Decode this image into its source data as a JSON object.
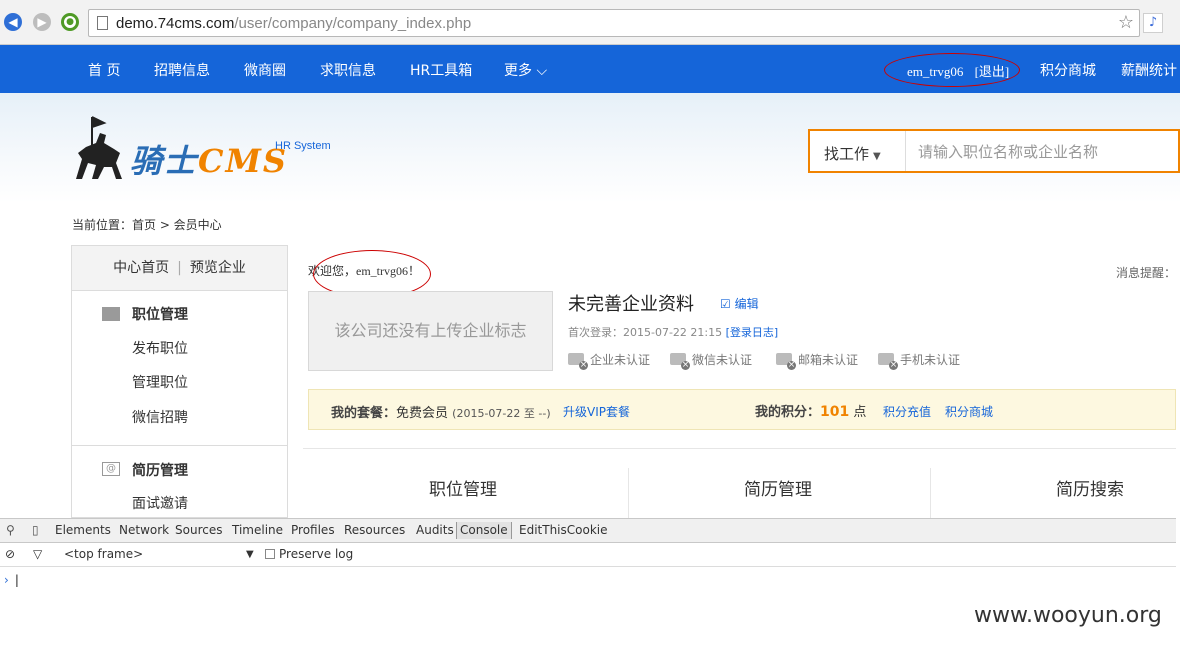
{
  "browser": {
    "url_host": "demo.74cms.com",
    "url_path": "/user/company/company_index.php"
  },
  "topnav": {
    "items": [
      "首 页",
      "招聘信息",
      "微商圈",
      "求职信息",
      "HR工具箱",
      "更多 ⌵"
    ],
    "username": "em_trvg06",
    "logout": "[退出]",
    "points_mall": "积分商城",
    "salary_stats": "薪酬统计"
  },
  "header": {
    "logo_text_main": "骑士",
    "logo_text_cms": "CMS",
    "hr_system": "HR System",
    "search_select": "找工作",
    "search_placeholder": "请输入职位名称或企业名称"
  },
  "breadcrumb": "当前位置：首页 > 会员中心",
  "sidebar": {
    "center_home": "中心首页",
    "preview_company": "预览企业",
    "groups": [
      {
        "title": "职位管理",
        "items": [
          "发布职位",
          "管理职位",
          "微信招聘"
        ]
      },
      {
        "title": "简历管理",
        "items": [
          "面试邀请"
        ]
      }
    ]
  },
  "main": {
    "welcome_prefix": "欢迎您，",
    "welcome_user": "em_trvg06",
    "welcome_suffix": "！",
    "message_hint": "消息提醒：",
    "no_logo": "该公司还没有上传企业标志",
    "company_title": "未完善企业资料",
    "edit": "编辑",
    "first_login_label": "首次登录：",
    "first_login_time": "2015-07-22 21:15",
    "login_log": "[登录日志]",
    "auth": [
      "企业未认证",
      "微信未认证",
      "邮箱未认证",
      "手机未认证"
    ],
    "package_label": "我的套餐：",
    "package_value": "免费会员",
    "package_period": "(2015-07-22 至 --)",
    "upgrade_vip": "升级VIP套餐",
    "points_label": "我的积分：",
    "points_value": "101",
    "points_unit": "点",
    "points_recharge": "积分充值",
    "points_mall": "积分商城",
    "columns": [
      "职位管理",
      "简历管理",
      "简历搜索"
    ]
  },
  "devtools": {
    "tabs": [
      "Elements",
      "Network",
      "Sources",
      "Timeline",
      "Profiles",
      "Resources",
      "Audits",
      "Console",
      "EditThisCookie"
    ],
    "active_tab": "Console",
    "frame": "<top frame>",
    "preserve_log": "Preserve log"
  },
  "watermark": "www.wooyun.org",
  "colors": {
    "nav_blue": "#1565d9",
    "accent_orange": "#f08300",
    "annotation_red": "#cc0000"
  }
}
